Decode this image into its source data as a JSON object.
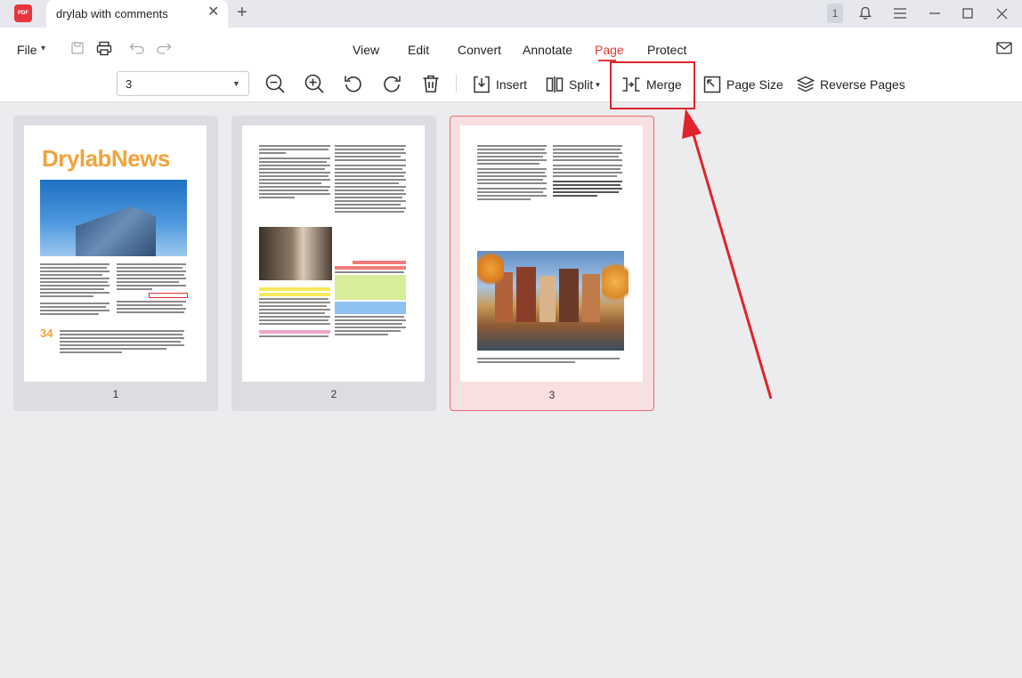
{
  "titlebar": {
    "app_logo_text": "PDF",
    "tab_title": "drylab with comments",
    "tab_close_icon": "close-icon",
    "new_tab_icon": "plus-icon",
    "notification_count": "1"
  },
  "menubar": {
    "file_label": "File",
    "items": [
      "View",
      "Edit",
      "Convert",
      "Annotate",
      "Page",
      "Protect"
    ],
    "active_item": "Page"
  },
  "toolbar": {
    "page_select_value": "3",
    "insert_label": "Insert",
    "split_label": "Split",
    "merge_label": "Merge",
    "page_size_label": "Page Size",
    "reverse_pages_label": "Reverse Pages"
  },
  "pages": [
    {
      "number": "1",
      "masthead": "DrylabNews"
    },
    {
      "number": "2"
    },
    {
      "number": "3",
      "selected": true
    }
  ],
  "colors": {
    "accent": "#e23a33",
    "highlight_box": "#e0242b",
    "selected_bg": "#f8dfe0"
  }
}
